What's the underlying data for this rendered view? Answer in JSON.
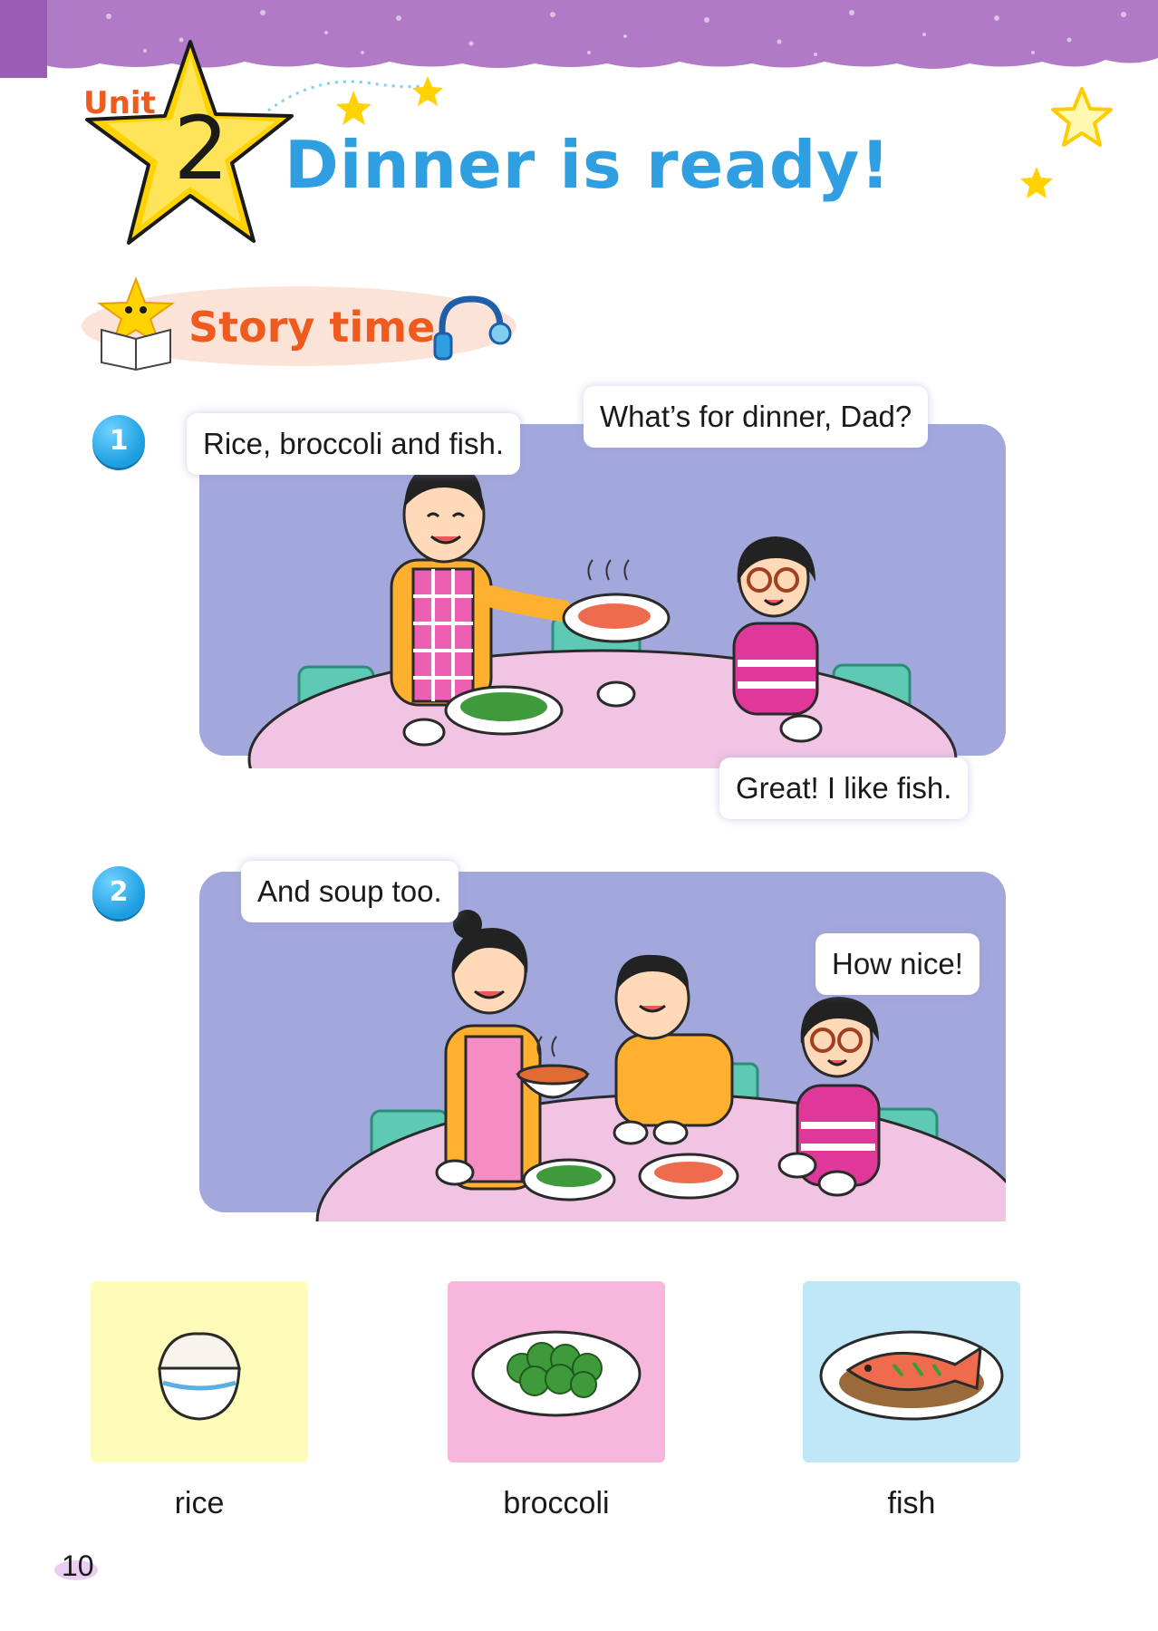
{
  "header": {
    "unit_label": "Unit",
    "unit_number": "2",
    "title": "Dinner is ready!"
  },
  "section": {
    "title": "Story time",
    "icon": "headphones-icon"
  },
  "story": [
    {
      "number": "1",
      "bubbles": {
        "dad": "Rice, broccoli and fish.",
        "girl_question": "What’s for dinner, Dad?",
        "girl_reply": "Great! I like fish."
      }
    },
    {
      "number": "2",
      "bubbles": {
        "mom": "And soup too.",
        "girl": "How nice!"
      }
    }
  ],
  "vocabulary": [
    {
      "word": "rice",
      "color": "#fffbb8"
    },
    {
      "word": "broccoli",
      "color": "#f7b6dc"
    },
    {
      "word": "fish",
      "color": "#bfe7f7"
    }
  ],
  "page_number": "10",
  "colors": {
    "banner": "#b07ac6",
    "title_blue": "#2f9fe2",
    "accent_orange": "#ef5a1e",
    "scene_bg": "#a3a8dc",
    "table_pink": "#f2c4e4"
  }
}
